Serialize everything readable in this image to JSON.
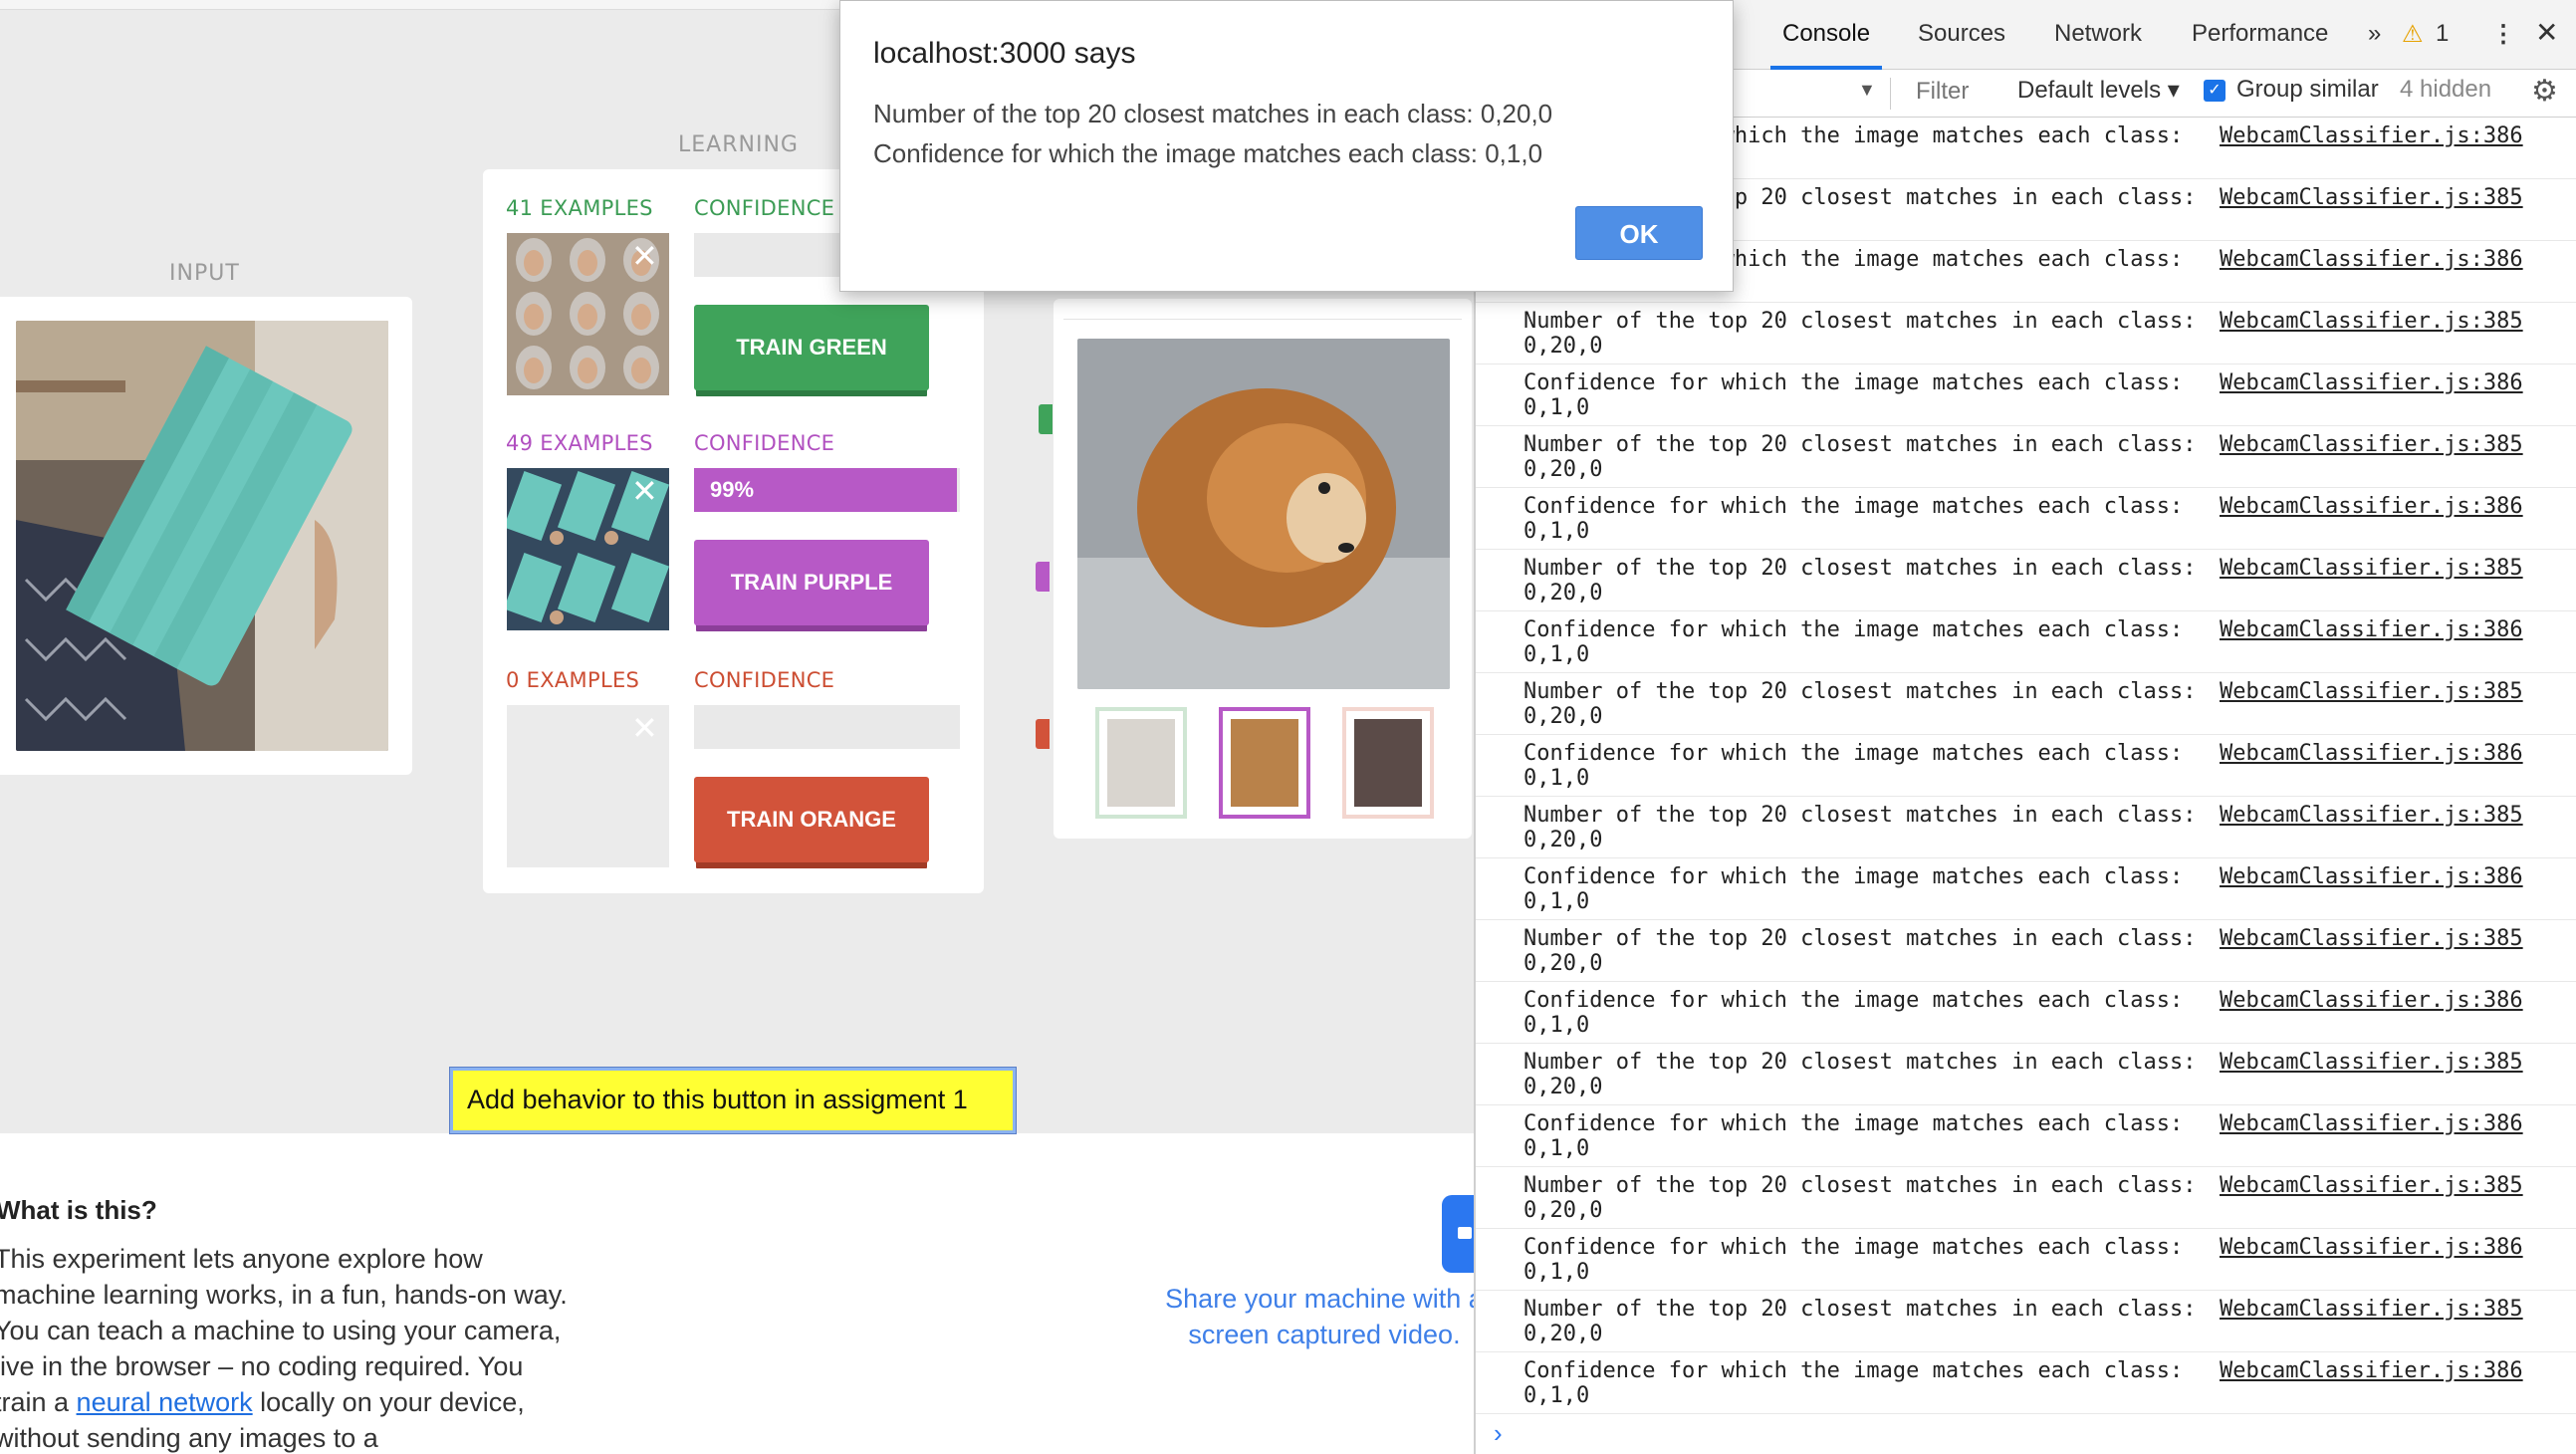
{
  "app": {
    "input_label": "INPUT",
    "learning_label": "LEARNING",
    "classes": [
      {
        "examples": "41 EXAMPLES",
        "confidence_label": "CONFIDENCE",
        "confidence_value": "",
        "confidence_fraction": 0,
        "button": "TRAIN GREEN",
        "color": "#3c9c55",
        "btn_color": "#3fa35a"
      },
      {
        "examples": "49 EXAMPLES",
        "confidence_label": "CONFIDENCE",
        "confidence_value": "99%",
        "confidence_fraction": 0.99,
        "button": "TRAIN PURPLE",
        "color": "#b150c0",
        "btn_color": "#b759c6"
      },
      {
        "examples": "0 EXAMPLES",
        "confidence_label": "CONFIDENCE",
        "confidence_value": "",
        "confidence_fraction": 0,
        "button": "TRAIN ORANGE",
        "color": "#cc4d32",
        "btn_color": "#d2533a"
      }
    ],
    "assign_button": "Add behavior to this button in assigment 1",
    "what_title": "What is this?",
    "what_body_1": "This experiment lets anyone explore how machine learning works, in a fun, hands-on way. You can teach a machine to using your camera, live in the browser – no coding required. You train a ",
    "what_link": "neural network",
    "what_body_2": " locally on your device, without sending any images to a",
    "share_text": "Share your machine with a screen captured video."
  },
  "alert": {
    "title": "localhost:3000 says",
    "line1": "Number of the top 20 closest matches in each class: 0,20,0",
    "line2": "Confidence for which the image matches each class: 0,1,0",
    "ok": "OK"
  },
  "devtools": {
    "tabs": [
      "Console",
      "Sources",
      "Network",
      "Performance"
    ],
    "more": "»",
    "warning_count": "1",
    "filter_placeholder": "Filter",
    "levels": "Default levels ▾",
    "group_similar": "Group similar",
    "hidden": "4 hidden",
    "rows": [
      {
        "msg": "Confidence for which the image matches each class:",
        "src": "WebcamClassifier.js:386",
        "val": ""
      },
      {
        "msg": "Number of the top 20 closest matches in each class:",
        "src": "WebcamClassifier.js:385",
        "val": ""
      },
      {
        "msg": "Confidence for which the image matches each class:",
        "src": "WebcamClassifier.js:386",
        "val": ""
      },
      {
        "msg": "Number of the top 20 closest matches in each class:",
        "src": "WebcamClassifier.js:385",
        "val": "0,20,0"
      },
      {
        "msg": "Confidence for which the image matches each class:",
        "src": "WebcamClassifier.js:386",
        "val": "0,1,0"
      },
      {
        "msg": "Number of the top 20 closest matches in each class:",
        "src": "WebcamClassifier.js:385",
        "val": "0,20,0"
      },
      {
        "msg": "Confidence for which the image matches each class:",
        "src": "WebcamClassifier.js:386",
        "val": "0,1,0"
      },
      {
        "msg": "Number of the top 20 closest matches in each class:",
        "src": "WebcamClassifier.js:385",
        "val": "0,20,0"
      },
      {
        "msg": "Confidence for which the image matches each class:",
        "src": "WebcamClassifier.js:386",
        "val": "0,1,0"
      },
      {
        "msg": "Number of the top 20 closest matches in each class:",
        "src": "WebcamClassifier.js:385",
        "val": "0,20,0"
      },
      {
        "msg": "Confidence for which the image matches each class:",
        "src": "WebcamClassifier.js:386",
        "val": "0,1,0"
      },
      {
        "msg": "Number of the top 20 closest matches in each class:",
        "src": "WebcamClassifier.js:385",
        "val": "0,20,0"
      },
      {
        "msg": "Confidence for which the image matches each class:",
        "src": "WebcamClassifier.js:386",
        "val": "0,1,0"
      },
      {
        "msg": "Number of the top 20 closest matches in each class:",
        "src": "WebcamClassifier.js:385",
        "val": "0,20,0"
      },
      {
        "msg": "Confidence for which the image matches each class:",
        "src": "WebcamClassifier.js:386",
        "val": "0,1,0"
      },
      {
        "msg": "Number of the top 20 closest matches in each class:",
        "src": "WebcamClassifier.js:385",
        "val": "0,20,0"
      },
      {
        "msg": "Confidence for which the image matches each class:",
        "src": "WebcamClassifier.js:386",
        "val": "0,1,0"
      },
      {
        "msg": "Number of the top 20 closest matches in each class:",
        "src": "WebcamClassifier.js:385",
        "val": "0,20,0"
      },
      {
        "msg": "Confidence for which the image matches each class:",
        "src": "WebcamClassifier.js:386",
        "val": "0,1,0"
      },
      {
        "msg": "Number of the top 20 closest matches in each class:",
        "src": "WebcamClassifier.js:385",
        "val": "0,20,0"
      },
      {
        "msg": "Confidence for which the image matches each class:",
        "src": "WebcamClassifier.js:386",
        "val": "0,1,0"
      }
    ],
    "prompt": "›"
  }
}
